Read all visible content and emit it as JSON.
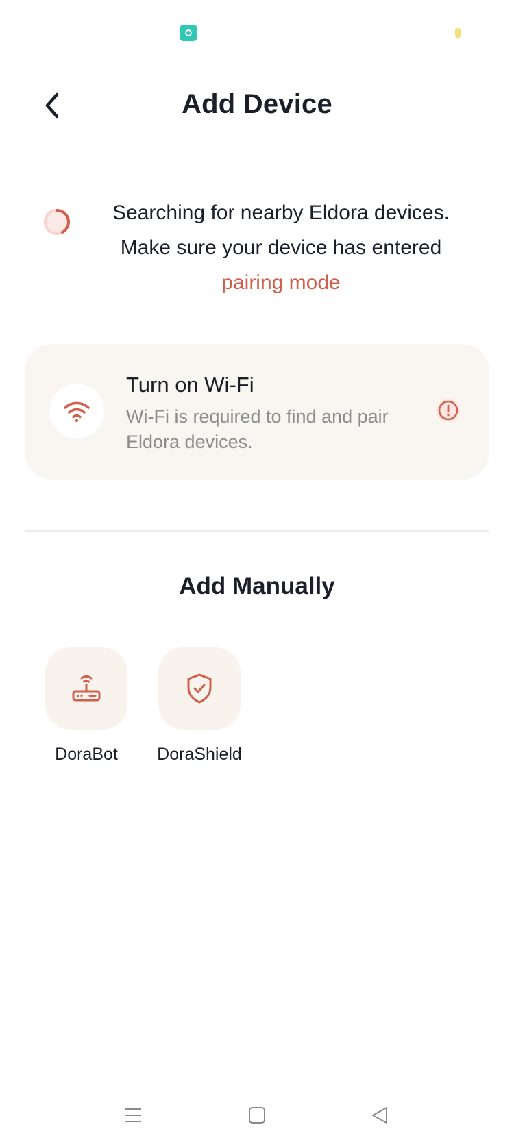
{
  "status_bar": {
    "app_icon": "app-notification-icon",
    "battery_icon": "battery-icon"
  },
  "header": {
    "title": "Add Device",
    "back_icon": "chevron-left-icon"
  },
  "search": {
    "line1": "Searching for nearby Eldora devices.",
    "line2": "Make sure your device has entered",
    "link": "pairing mode",
    "spinner_icon": "loading-spinner-icon"
  },
  "wifi_card": {
    "title": "Turn on Wi-Fi",
    "description": "Wi-Fi is required to find and pair Eldora devices.",
    "icon": "wifi-icon",
    "status_icon": "alert-circle-icon"
  },
  "manual": {
    "title": "Add Manually",
    "devices": [
      {
        "label": "DoraBot",
        "icon": "router-icon"
      },
      {
        "label": "DoraShield",
        "icon": "shield-check-icon"
      }
    ]
  },
  "nav_bar": {
    "menu_icon": "menu-icon",
    "home_icon": "square-home-icon",
    "back_icon": "triangle-back-icon"
  },
  "colors": {
    "accent": "#d25f4c",
    "text_primary": "#1c1f2a",
    "text_secondary": "#8c8c8c",
    "card_bg": "#f9f6f2",
    "tile_bg": "#f9f3ee"
  }
}
